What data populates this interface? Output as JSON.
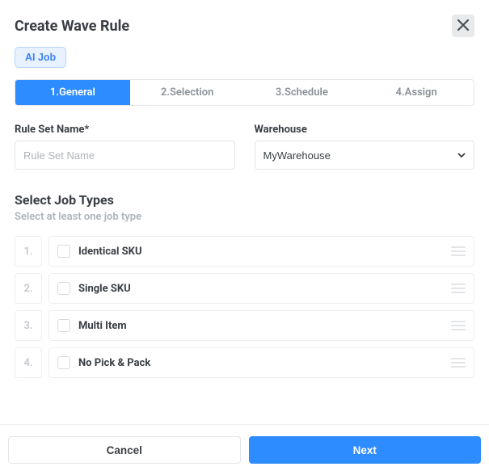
{
  "header": {
    "title": "Create Wave Rule",
    "ai_job_label": "AI Job"
  },
  "tabs": {
    "0": {
      "label": "1.General"
    },
    "1": {
      "label": "2.Selection"
    },
    "2": {
      "label": "3.Schedule"
    },
    "3": {
      "label": "4.Assign"
    }
  },
  "form": {
    "rule_set": {
      "label": "Rule Set Name*",
      "placeholder": "Rule Set Name",
      "value": ""
    },
    "warehouse": {
      "label": "Warehouse",
      "value": "MyWarehouse"
    }
  },
  "job_types": {
    "title": "Select Job Types",
    "subtitle": "Select at least one job type",
    "items": {
      "0": {
        "num": "1.",
        "label": "Identical SKU"
      },
      "1": {
        "num": "2.",
        "label": "Single SKU"
      },
      "2": {
        "num": "3.",
        "label": "Multi Item"
      },
      "3": {
        "num": "4.",
        "label": "No Pick & Pack"
      }
    }
  },
  "footer": {
    "cancel": "Cancel",
    "next": "Next"
  }
}
